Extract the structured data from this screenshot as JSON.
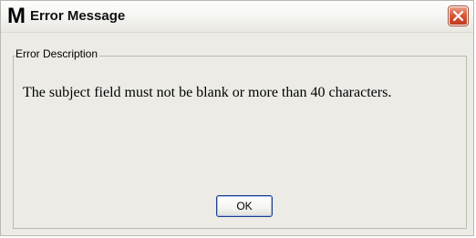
{
  "window": {
    "app_logo": "M",
    "title": "Error Message",
    "close_icon": "close-x-icon",
    "colors": {
      "close_button": "#d9583a",
      "dialog_background": "#ecebe6"
    }
  },
  "error_group": {
    "legend": "Error Description",
    "message": "The subject field must not be blank or more than 40 characters."
  },
  "buttons": {
    "ok_label": "OK"
  }
}
